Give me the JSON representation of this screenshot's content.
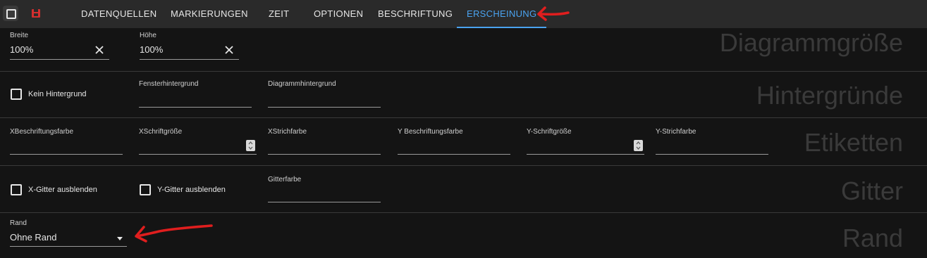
{
  "toolbar": {
    "icons": {
      "select": "checkbox-square-icon",
      "save": "floppy-save-icon"
    },
    "tabs": [
      {
        "label": "DATENQUELLEN"
      },
      {
        "label": "MARKIERUNGEN"
      },
      {
        "label": "ZEIT"
      },
      {
        "label": "OPTIONEN"
      },
      {
        "label": "BESCHRIFTUNG"
      },
      {
        "label": "ERSCHEINUNG"
      }
    ],
    "active_tab": "ERSCHEINUNG",
    "accent_color": "#4aa3f0",
    "save_icon_color": "#d32f2f"
  },
  "annotations": {
    "arrow_color": "#e01e1e"
  },
  "sections": {
    "size": {
      "title": "Diagrammgröße",
      "width": {
        "label": "Breite",
        "value": "100%"
      },
      "height": {
        "label": "Höhe",
        "value": "100%"
      }
    },
    "backgrounds": {
      "title": "Hintergründe",
      "no_background": {
        "label": "Kein Hintergrund",
        "checked": false
      },
      "window_bg": {
        "label": "Fensterhintergrund",
        "value": ""
      },
      "chart_bg": {
        "label": "Diagrammhintergrund",
        "value": ""
      }
    },
    "labels": {
      "title": "Etiketten",
      "x_label_color": {
        "label": "XBeschriftungsfarbe",
        "value": ""
      },
      "x_font_size": {
        "label": "XSchriftgröße",
        "value": ""
      },
      "x_stroke_color": {
        "label": "XStrichfarbe",
        "value": ""
      },
      "y_label_color": {
        "label": "Y Beschriftungsfarbe",
        "value": ""
      },
      "y_font_size": {
        "label": "Y-Schriftgröße",
        "value": ""
      },
      "y_stroke_color": {
        "label": "Y-Strichfarbe",
        "value": ""
      }
    },
    "grid": {
      "title": "Gitter",
      "hide_x_grid": {
        "label": "X-Gitter ausblenden",
        "checked": false
      },
      "hide_y_grid": {
        "label": "Y-Gitter ausblenden",
        "checked": false
      },
      "grid_color": {
        "label": "Gitterfarbe",
        "value": ""
      }
    },
    "border": {
      "title": "Rand",
      "border": {
        "label": "Rand",
        "value": "Ohne Rand"
      }
    }
  }
}
